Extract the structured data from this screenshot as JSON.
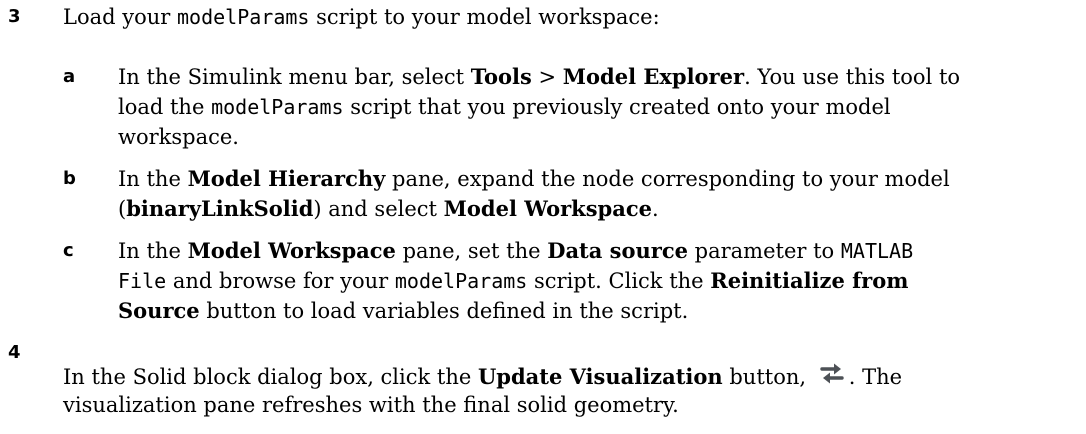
{
  "step3": {
    "number": "3",
    "intro": [
      "Load your ",
      "modelParams",
      " script to your model workspace:"
    ],
    "a": {
      "letter": "a",
      "line1": [
        "In the Simulink menu bar, select ",
        "Tools",
        " > ",
        "Model Explorer",
        ". You use this tool to"
      ],
      "line2": [
        "load the ",
        "modelParams",
        " script that you previously created onto your model"
      ],
      "line3": "workspace."
    },
    "b": {
      "letter": "b",
      "line1": [
        "In the ",
        "Model Hierarchy",
        " pane, expand the node corresponding to your model"
      ],
      "line2": [
        "(",
        "binaryLinkSolid",
        ") and select ",
        "Model Workspace",
        "."
      ]
    },
    "c": {
      "letter": "c",
      "line1": [
        "In the ",
        "Model Workspace",
        " pane, set the ",
        "Data source",
        " parameter to ",
        "MATLAB"
      ],
      "line2": [
        "File",
        " and browse for your ",
        "modelParams",
        " script. Click the ",
        "Reinitialize from"
      ],
      "line3": [
        "Source",
        " button to load variables defined in the script."
      ]
    }
  },
  "step4": {
    "number": "4",
    "line1": [
      "In the Solid block dialog box, click the ",
      "Update Visualization",
      " button, ",
      ". The"
    ],
    "icon": "update-visualization-icon",
    "line2": "visualization pane refreshes with the final solid geometry."
  }
}
